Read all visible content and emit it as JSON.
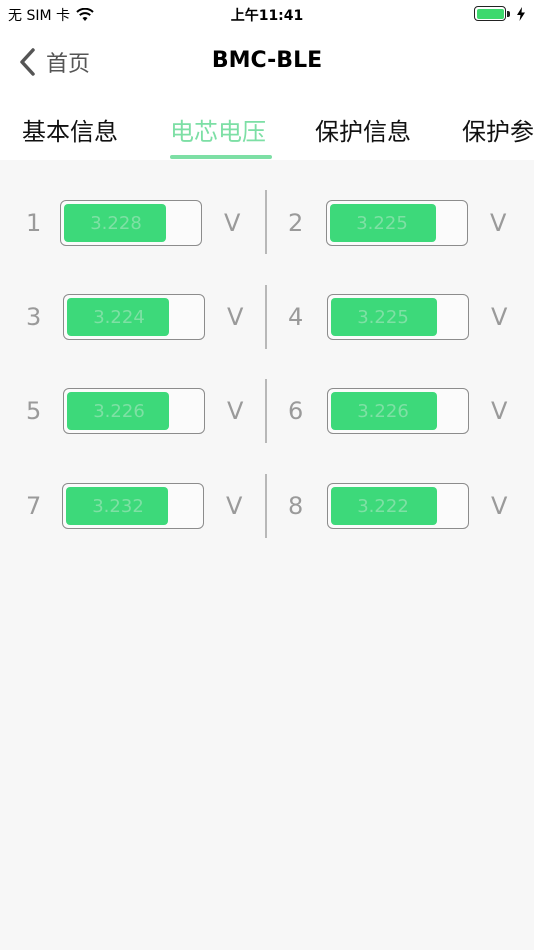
{
  "status_bar": {
    "carrier": "无 SIM 卡",
    "time": "上午11:41",
    "wifi_icon": "wifi-icon",
    "battery_icon": "battery-icon",
    "charging_icon": "charging-bolt-icon"
  },
  "nav": {
    "back_label": "首页",
    "title": "BMC-BLE"
  },
  "tabs": [
    {
      "label": "基本信息",
      "active": false
    },
    {
      "label": "电芯电压",
      "active": true
    },
    {
      "label": "保护信息",
      "active": false
    },
    {
      "label": "保护参",
      "active": false
    }
  ],
  "accent_color": "#7ddfa5",
  "fill_color": "#3dd97a",
  "cells": [
    {
      "index": "1",
      "value": "3.228",
      "unit": "V",
      "fill_ratio": 0.75
    },
    {
      "index": "2",
      "value": "3.225",
      "unit": "V",
      "fill_ratio": 0.78
    },
    {
      "index": "3",
      "value": "3.224",
      "unit": "V",
      "fill_ratio": 0.75
    },
    {
      "index": "4",
      "value": "3.225",
      "unit": "V",
      "fill_ratio": 0.78
    },
    {
      "index": "5",
      "value": "3.226",
      "unit": "V",
      "fill_ratio": 0.75
    },
    {
      "index": "6",
      "value": "3.226",
      "unit": "V",
      "fill_ratio": 0.78
    },
    {
      "index": "7",
      "value": "3.232",
      "unit": "V",
      "fill_ratio": 0.75
    },
    {
      "index": "8",
      "value": "3.222",
      "unit": "V",
      "fill_ratio": 0.78
    }
  ]
}
